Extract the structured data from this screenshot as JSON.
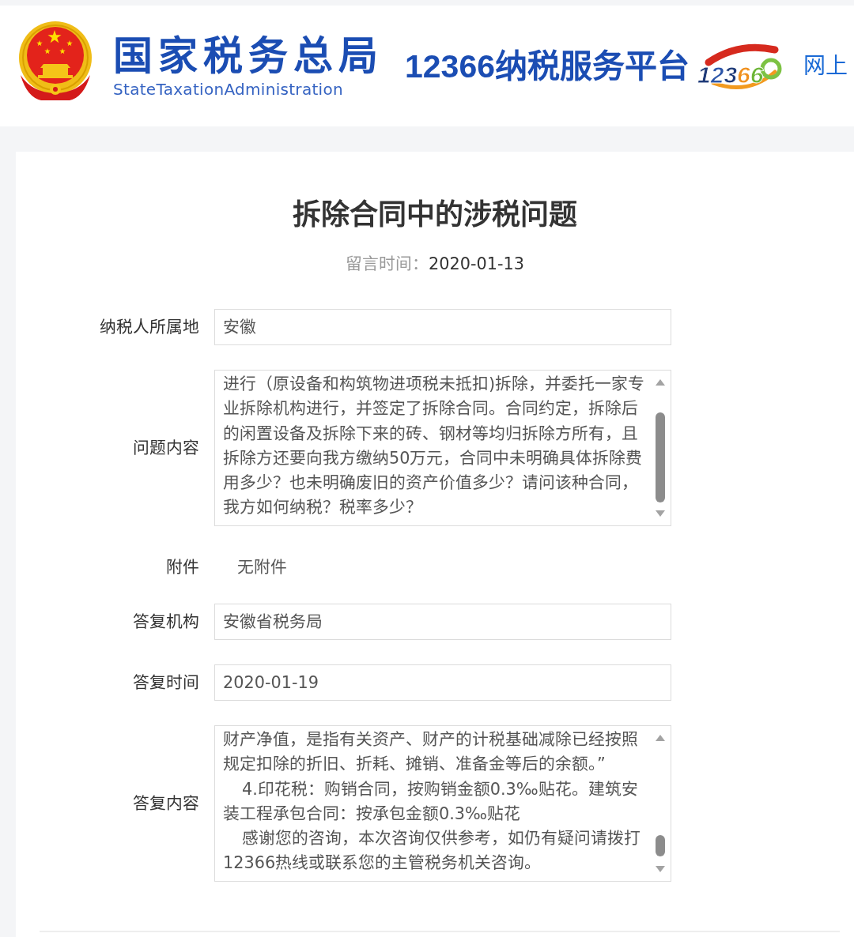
{
  "header": {
    "agency_name": "国家税务总局",
    "agency_name_en": "StateTaxationAdministration",
    "platform_name": "12366纳税服务平台",
    "logo_text": "12366",
    "nav_link": "网上"
  },
  "article": {
    "title": "拆除合同中的涉税问题",
    "date_label": "留言时间：",
    "date": "2020-01-13"
  },
  "fields": [
    {
      "kind": "input",
      "label": "纳税人所属地",
      "value": "安徽"
    },
    {
      "kind": "textarea",
      "label": "问题内容",
      "paragraphs": [
        {
          "text": "进行（原设备和构筑物进项税未抵扣)拆除，并委托一家专业拆除机构进行，并签定了拆除合同。合同约定，拆除后的闲置设备及拆除下来的砖、钢材等均归拆除方所有，且拆除方还要向我方缴纳50万元，合同中未明确具体拆除费用多少？也未明确废旧的资产价值多少？请问该种合同，我方如何纳税？税率多少？",
          "indented": false
        }
      ]
    },
    {
      "kind": "text",
      "label": "附件",
      "value": "无附件"
    },
    {
      "kind": "input",
      "label": "答复机构",
      "value": "安徽省税务局"
    },
    {
      "kind": "input",
      "label": "答复时间",
      "value": "2020-01-19"
    },
    {
      "kind": "textarea",
      "label": "答复内容",
      "paragraphs": [
        {
          "text": "财产净值，是指有关资产、财产的计税基础减除已经按照规定扣除的折旧、折耗、摊销、准备金等后的余额。”",
          "indented": false
        },
        {
          "text": "4.印花税：购销合同，按购销金额0.3‰贴花。建筑安装工程承包合同：按承包金额0.3‰贴花",
          "indented": true
        },
        {
          "text": "感谢您的咨询，本次咨询仅供参考，如仍有疑问请拨打12366热线或联系您的主管税务机关咨询。",
          "indented": true
        }
      ]
    }
  ]
}
